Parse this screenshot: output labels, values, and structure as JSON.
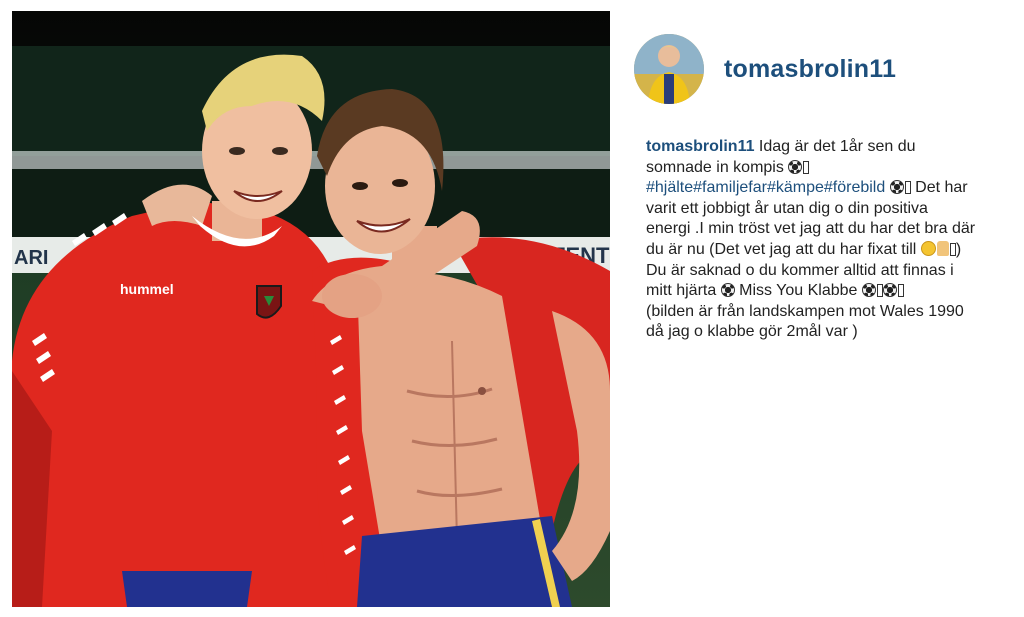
{
  "post": {
    "image_alt": "Two footballers in red shirts embracing and smiling on a pitch at night",
    "username": "tomasbrolin11",
    "caption": {
      "username": "tomasbrolin11",
      "line1": " Idag är det 1år sen du somnade in kompis ",
      "hashtags": "#hjälte#familjefar#kämpe#förebild",
      "line2": " Det har varit ett jobbigt år utan dig o din positiva energi .I min tröst vet jag att du har det bra där du är nu (Det vet jag att du har fixat till ",
      "line3": ") Du är saknad o du kommer alltid att finnas i mitt hjärta ",
      "line4": " Miss You Klabbe ",
      "line5": "        (bilden är från landskampen mot Wales 1990 då jag o klabbe gör 2mål var )"
    },
    "jersey_text": "hummel",
    "banner_text": "FENTER",
    "banner_left_text": "ARI"
  },
  "colors": {
    "username": "#1d4f7c",
    "jersey_red": "#e0281f",
    "shorts_blue": "#22318f"
  },
  "icons": [
    "soccer-ball-icon",
    "smiley-icon",
    "thumbs-up-icon"
  ]
}
